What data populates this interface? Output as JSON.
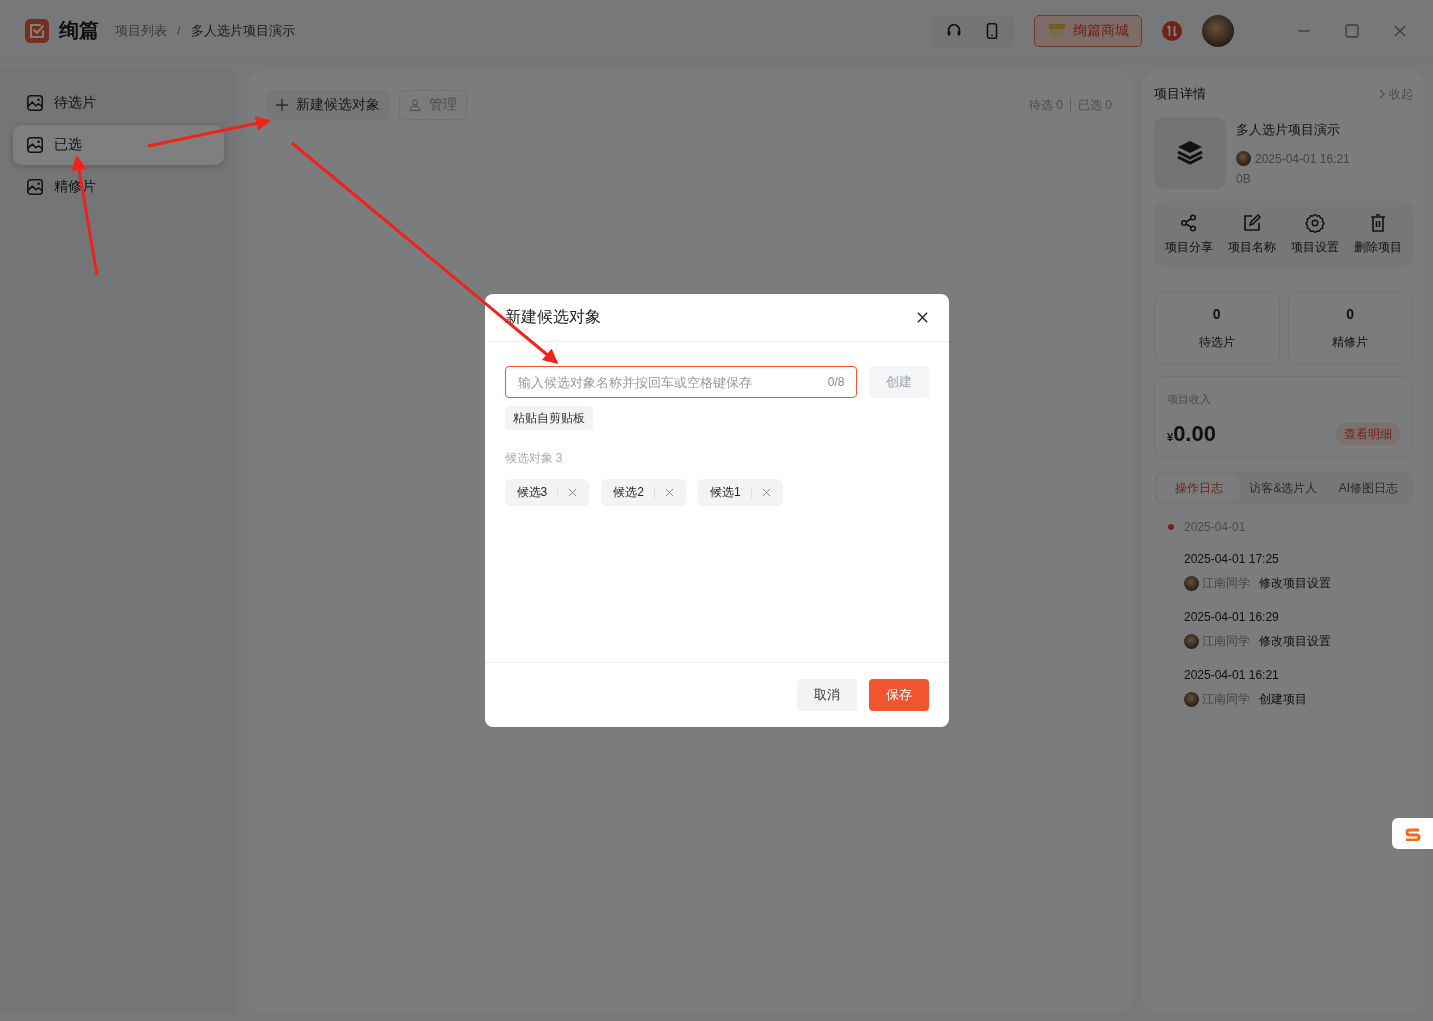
{
  "header": {
    "app_name": "绚篇",
    "breadcrumb": [
      "项目列表",
      "多人选片项目演示"
    ],
    "separator": "/",
    "store_button": "绚篇商城"
  },
  "sidebar": {
    "items": [
      {
        "label": "待选片",
        "selected": false
      },
      {
        "label": "已选",
        "selected": true
      },
      {
        "label": "精修片",
        "selected": false
      }
    ]
  },
  "toolbar": {
    "new_button": "新建候选对象",
    "manage_button": "管理",
    "counts": [
      "待选 0",
      "已选 0"
    ]
  },
  "details": {
    "title": "项目详情",
    "collapse": "收起",
    "project_name": "多人选片项目演示",
    "created": "2025-04-01 16:21",
    "size": "0B",
    "actions": [
      {
        "kind": "share",
        "label": "项目分享"
      },
      {
        "kind": "edit",
        "label": "项目名称"
      },
      {
        "kind": "settings",
        "label": "项目设置"
      },
      {
        "kind": "delete",
        "label": "删除项目"
      }
    ],
    "stats": [
      {
        "value": "0",
        "label": "待选片"
      },
      {
        "value": "0",
        "label": "精修片"
      }
    ],
    "income": {
      "label": "项目收入",
      "currency": "¥",
      "amount": "0.00",
      "detail_button": "查看明细"
    },
    "log_tabs": [
      {
        "label": "操作日志",
        "selected": true
      },
      {
        "label": "访客&选片人",
        "selected": false
      },
      {
        "label": "AI修图日志",
        "selected": false
      }
    ],
    "log_date": "2025-04-01",
    "log": [
      {
        "time": "2025-04-01 17:25",
        "user": "江南同学",
        "action": "修改项目设置"
      },
      {
        "time": "2025-04-01 16:29",
        "user": "江南同学",
        "action": "修改项目设置"
      },
      {
        "time": "2025-04-01 16:21",
        "user": "江南同学",
        "action": "创建项目"
      }
    ]
  },
  "dialog": {
    "title": "新建候选对象",
    "placeholder": "输入候选对象名称并按回车或空格键保存",
    "counter": "0/8",
    "create_button": {
      "label": "创建",
      "disabled": true
    },
    "paste_button": "粘贴自剪贴板",
    "candidates_label": "候选对象 3",
    "candidates": [
      "候选3",
      "候选2",
      "候选1"
    ],
    "cancel_button": "取消",
    "save_button": "保存"
  }
}
